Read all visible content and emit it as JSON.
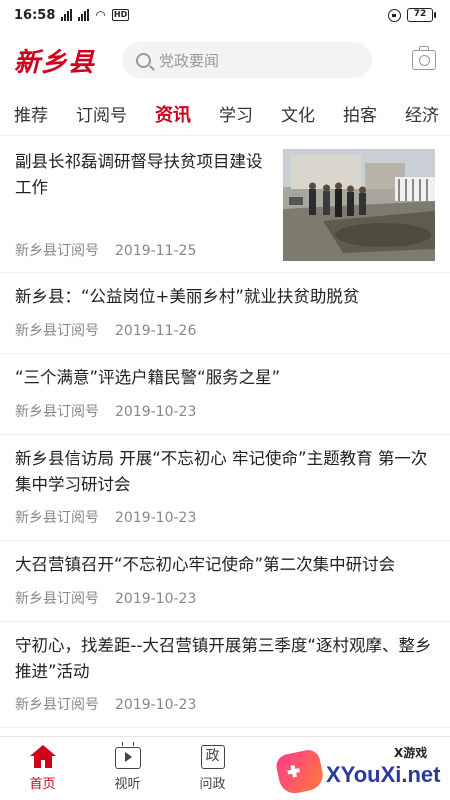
{
  "status_bar": {
    "time": "16:58",
    "network_type": "HD",
    "battery": "72"
  },
  "header": {
    "logo_text": "新乡县",
    "search_placeholder": "党政要闻"
  },
  "tabs": [
    {
      "label": "推荐",
      "active": false
    },
    {
      "label": "订阅号",
      "active": false
    },
    {
      "label": "资讯",
      "active": true
    },
    {
      "label": "学习",
      "active": false
    },
    {
      "label": "文化",
      "active": false
    },
    {
      "label": "拍客",
      "active": false
    },
    {
      "label": "经济",
      "active": false
    }
  ],
  "news": [
    {
      "title": "副县长祁磊调研督导扶贫项目建设工作",
      "source": "新乡县订阅号",
      "date": "2019-11-25",
      "has_thumb": true
    },
    {
      "title": "新乡县：“公益岗位+美丽乡村”就业扶贫助脱贫",
      "source": "新乡县订阅号",
      "date": "2019-11-26"
    },
    {
      "title": "“三个满意”评选户籍民警“服务之星”",
      "source": "新乡县订阅号",
      "date": "2019-10-23"
    },
    {
      "title": "新乡县信访局 开展“不忘初心 牢记使命”主题教育 第一次集中学习研讨会",
      "source": "新乡县订阅号",
      "date": "2019-10-23"
    },
    {
      "title": "大召营镇召开“不忘初心牢记使命”第二次集中研讨会",
      "source": "新乡县订阅号",
      "date": "2019-10-23"
    },
    {
      "title": "守初心，找差距--大召营镇开展第三季度“逐村观摩、整乡推进”活动",
      "source": "新乡县订阅号",
      "date": "2019-10-23"
    }
  ],
  "bottom_nav": [
    {
      "label": "首页",
      "active": true,
      "icon": "home-icon"
    },
    {
      "label": "视听",
      "active": false,
      "icon": "tv-icon"
    },
    {
      "label": "问政",
      "active": false,
      "icon": "zheng-icon",
      "icon_text": "政"
    }
  ],
  "watermark": {
    "site": "XYouXi.net",
    "tag": "X游戏"
  },
  "colors": {
    "accent": "#d0021b",
    "text": "#222222",
    "meta": "#888888"
  }
}
